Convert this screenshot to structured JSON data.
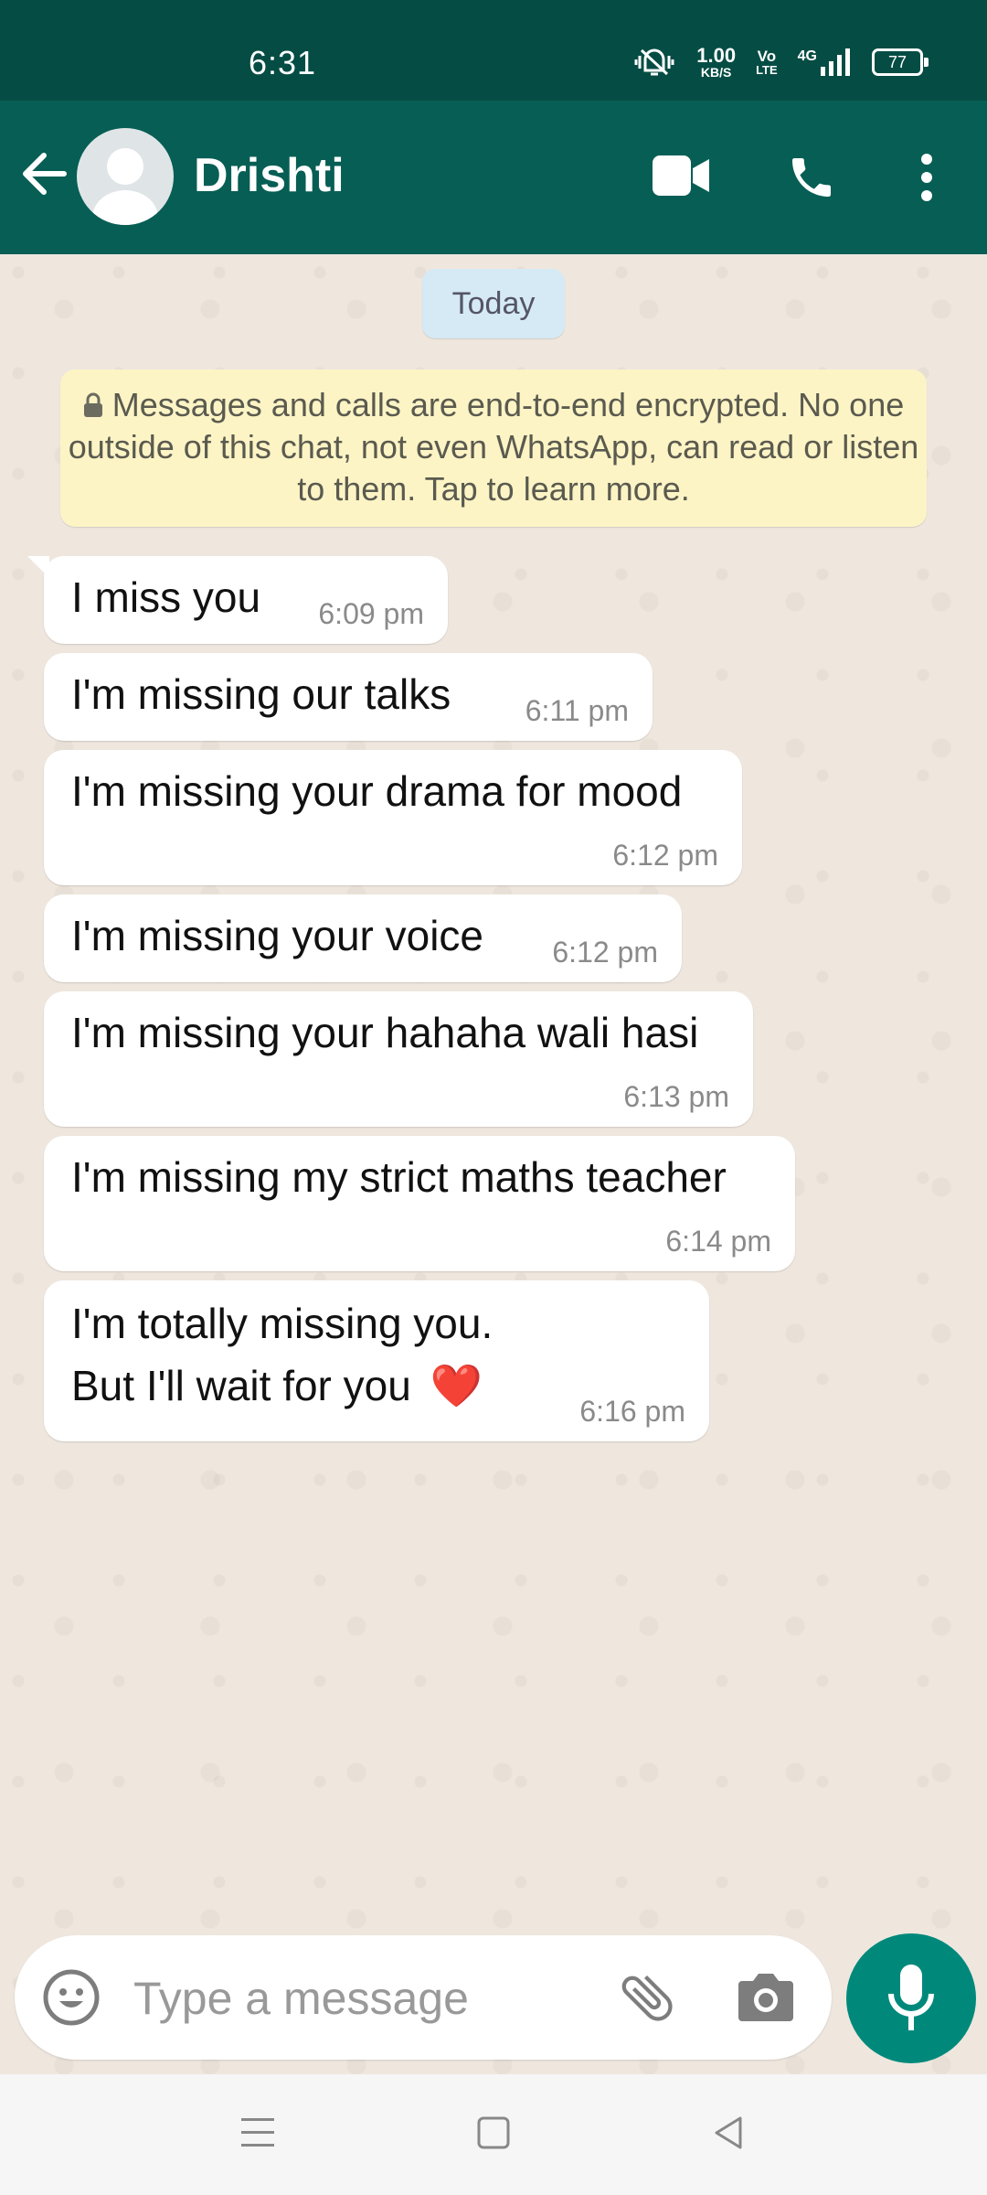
{
  "status_bar": {
    "time": "6:31",
    "speed_value": "1.00",
    "speed_unit": "KB/S",
    "volte_top": "Vo",
    "volte_bottom": "LTE",
    "network": "4G",
    "battery": "77"
  },
  "header": {
    "contact_name": "Drishti"
  },
  "chat": {
    "date_chip": "Today",
    "encryption_notice": "Messages and calls are end-to-end encrypted. No one outside of this chat, not even WhatsApp, can read or listen to them. Tap to learn more.",
    "messages": [
      {
        "text": "I miss you",
        "time": "6:09 pm"
      },
      {
        "text": "I'm missing our talks",
        "time": "6:11 pm"
      },
      {
        "text": "I'm missing your drama for mood",
        "time": "6:12 pm"
      },
      {
        "text": "I'm missing your voice",
        "time": "6:12 pm"
      },
      {
        "text": "I'm missing your hahaha wali hasi",
        "time": "6:13 pm"
      },
      {
        "text": "I'm missing my strict maths teacher",
        "time": "6:14 pm"
      },
      {
        "text_line1": "I'm totally missing you.",
        "text_line2": "But I'll wait for you",
        "emoji": "❤️",
        "time": "6:16 pm"
      }
    ]
  },
  "composer": {
    "placeholder": "Type a message"
  },
  "colors": {
    "header": "#075E54",
    "status_bar": "#054D44",
    "accent": "#00897B",
    "notice_bg": "#FDF4C5",
    "chat_bg": "#EFE7DE"
  }
}
